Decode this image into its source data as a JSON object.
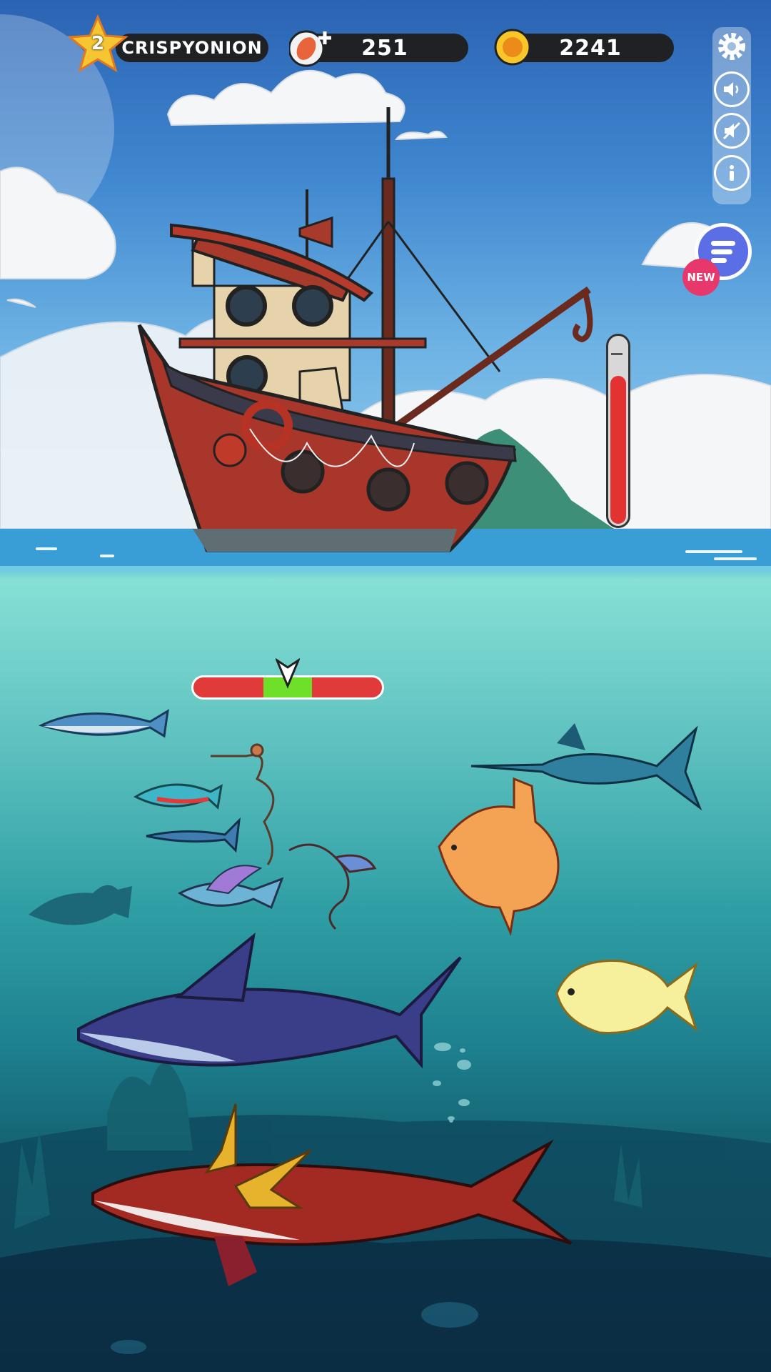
{
  "player": {
    "level": "2",
    "name": "CRISPYONION"
  },
  "currencies": {
    "bait": {
      "value": "251",
      "icon": "bait-plus-icon"
    },
    "coins": {
      "value": "2241",
      "icon": "coin-icon"
    }
  },
  "side_menu": {
    "buttons": [
      "settings-gear-icon",
      "sound-on-icon",
      "vibration-off-icon",
      "info-icon"
    ]
  },
  "menu_button": {
    "badge": "NEW"
  },
  "tension_meter": {
    "level": 0.78,
    "color": "#e23232"
  },
  "catch_bar": {
    "zone_start": 0.37,
    "zone_end": 0.63,
    "marker": 0.5,
    "zone_color": "#6fe02a",
    "bar_color": "#e03a3a"
  },
  "creatures": [
    "mackerel",
    "neon-tetra",
    "barracuda",
    "leafy-seadragon",
    "weedy-seadragon",
    "flying-fish",
    "silhouette-fish",
    "swordfish",
    "ocean-sunfish",
    "yellow-moonfish",
    "purple-shark",
    "red-dragon-whale"
  ]
}
